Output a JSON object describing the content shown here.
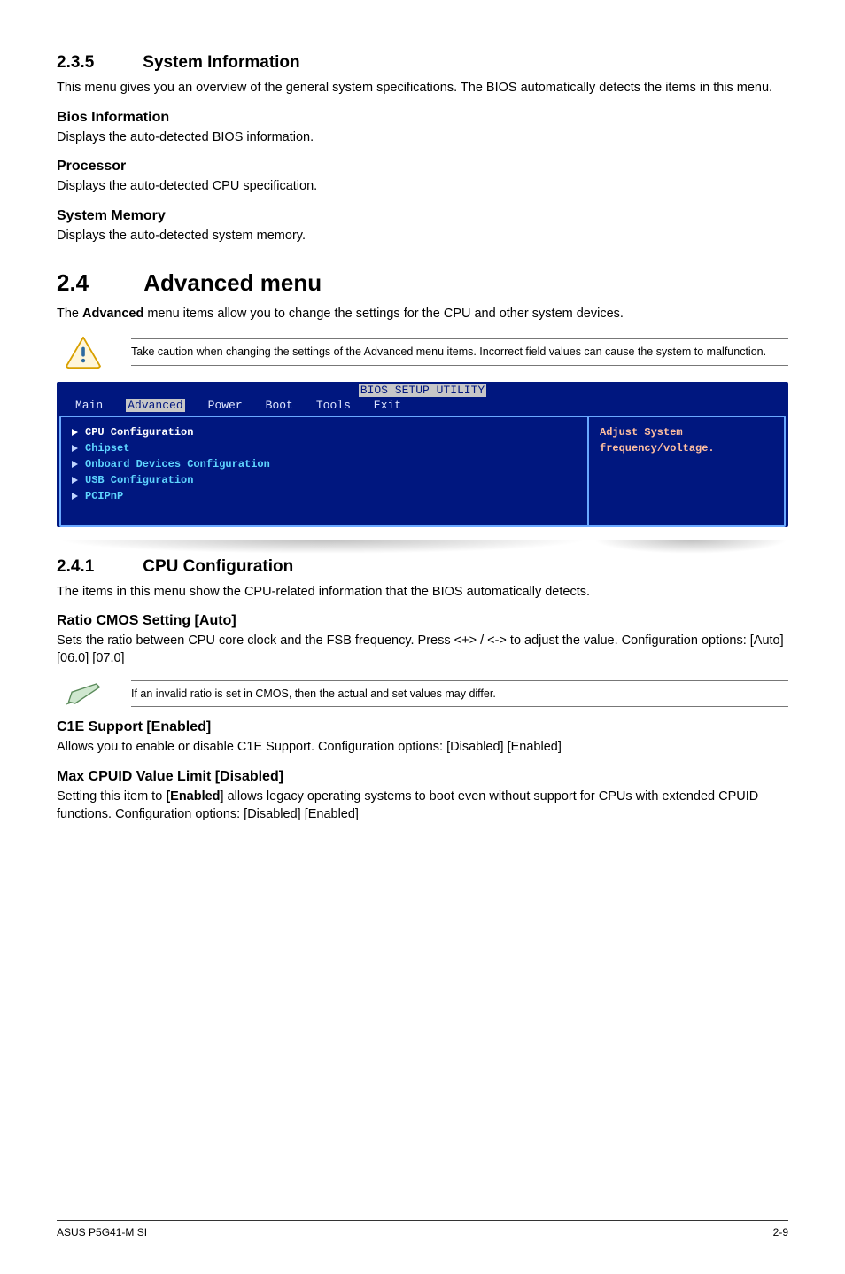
{
  "section_235": {
    "num": "2.3.5",
    "title": "System Information"
  },
  "p_235_intro": "This menu gives you an overview of the general system specifications. The BIOS automatically detects the items in this menu.",
  "bios_info": {
    "h": "Bios Information",
    "p": "Displays the auto-detected BIOS information."
  },
  "processor": {
    "h": "Processor",
    "p": "Displays the auto-detected CPU specification."
  },
  "sysmem": {
    "h": "System Memory",
    "p": "Displays the auto-detected system memory."
  },
  "section_24": {
    "num": "2.4",
    "title": "Advanced menu"
  },
  "p_24_lead_a": "The ",
  "p_24_lead_bold": "Advanced",
  "p_24_lead_b": " menu items allow you to change the settings for the CPU and other system devices.",
  "warn_24": "Take caution when changing the settings of the Advanced menu items. Incorrect field values can cause the system to malfunction.",
  "bios": {
    "title": "BIOS SETUP UTILITY",
    "tabs": {
      "main": "Main",
      "advanced": "Advanced",
      "power": "Power",
      "boot": "Boot",
      "tools": "Tools",
      "exit": "Exit"
    },
    "items": {
      "cpu": "CPU Configuration",
      "chipset": "Chipset",
      "onboard": "Onboard Devices Configuration",
      "usb": "USB Configuration",
      "pcipnp": "PCIPnP"
    },
    "help1": "Adjust System",
    "help2": "frequency/voltage."
  },
  "section_241": {
    "num": "2.4.1",
    "title": "CPU Configuration"
  },
  "p_241_intro": "The items in this menu show the CPU-related information that the BIOS automatically detects.",
  "ratio": {
    "h": "Ratio CMOS Setting [Auto]",
    "p": "Sets the ratio between CPU core clock and the FSB frequency. Press <+> / <-> to adjust the value. Configuration options: [Auto] [06.0] [07.0]"
  },
  "note_ratio": "If an invalid ratio is set in CMOS, then the actual and set values may differ.",
  "c1e": {
    "h": "C1E Support [Enabled]",
    "p": "Allows you to enable or disable C1E Support. Configuration options: [Disabled] [Enabled]"
  },
  "cpuid": {
    "h": "Max CPUID Value Limit [Disabled]",
    "p_a": "Setting this item to ",
    "p_bold": "[Enabled",
    "p_b": "] allows legacy operating systems to boot even without support for CPUs with extended CPUID functions. Configuration options: [Disabled] [Enabled]"
  },
  "footer": {
    "left": "ASUS P5G41-M SI",
    "right": "2-9"
  }
}
